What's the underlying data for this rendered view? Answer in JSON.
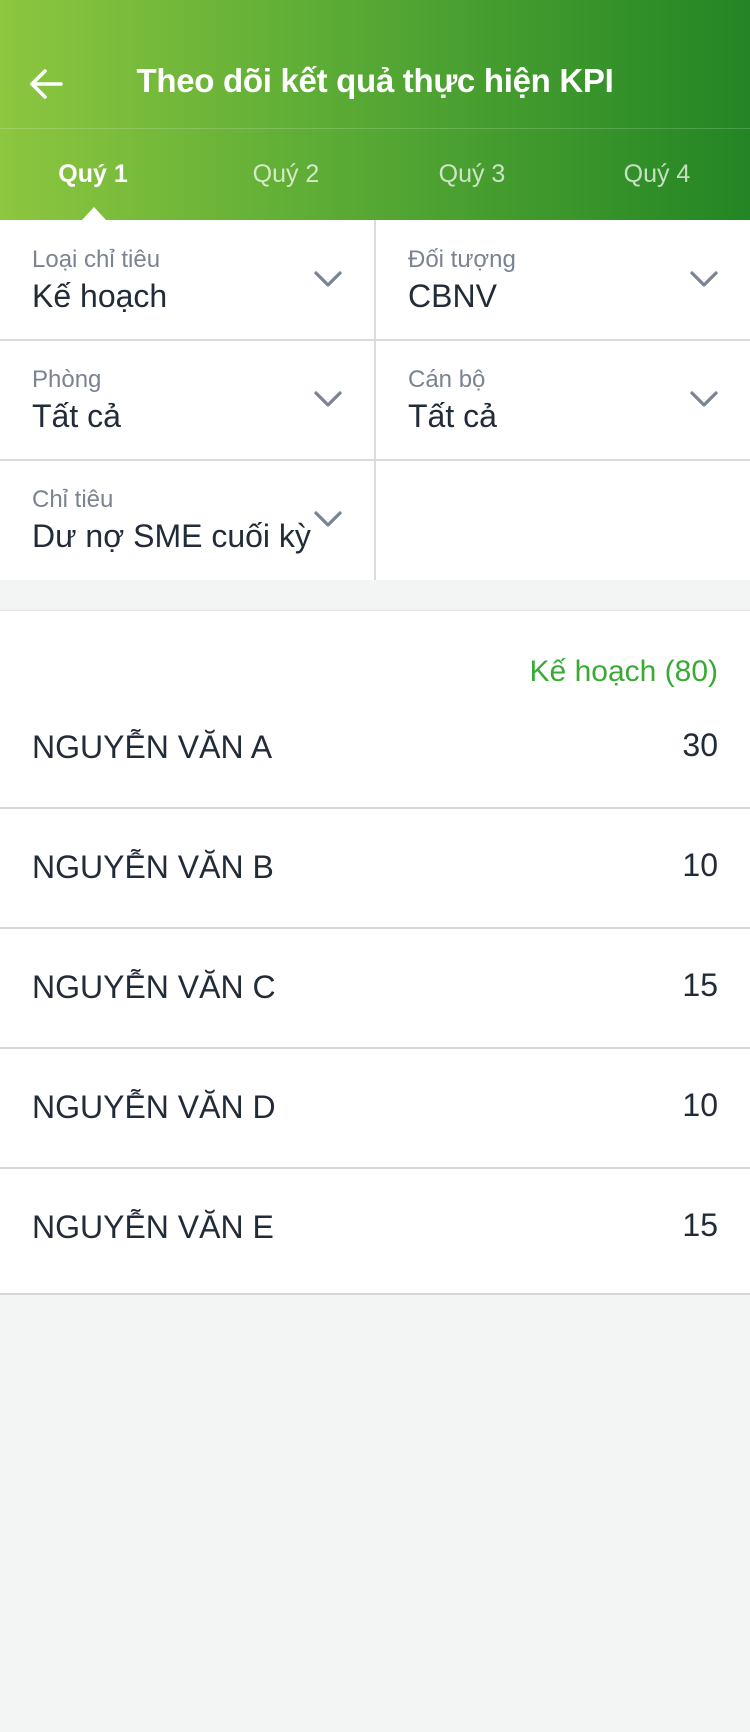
{
  "header": {
    "title": "Theo dõi kết quả thực hiện KPI",
    "back_icon": "arrow-left-icon"
  },
  "tabs": [
    {
      "label": "Quý 1",
      "active": true
    },
    {
      "label": "Quý 2",
      "active": false
    },
    {
      "label": "Quý 3",
      "active": false
    },
    {
      "label": "Quý 4",
      "active": false
    }
  ],
  "filters": {
    "loai_chi_tieu": {
      "label": "Loại chỉ tiêu",
      "value": "Kế hoạch"
    },
    "doi_tuong": {
      "label": "Đối tượng",
      "value": "CBNV"
    },
    "phong": {
      "label": "Phòng",
      "value": "Tất cả"
    },
    "can_bo": {
      "label": "Cán bộ",
      "value": "Tất cả"
    },
    "chi_tieu": {
      "label": "Chỉ tiêu",
      "value": "Dư nợ SME cuối kỳ"
    }
  },
  "list": {
    "header": "Kế hoạch (80)",
    "rows": [
      {
        "name": "NGUYỄN VĂN A",
        "value": "30"
      },
      {
        "name": "NGUYỄN VĂN B",
        "value": "10"
      },
      {
        "name": "NGUYỄN VĂN C",
        "value": "15"
      },
      {
        "name": "NGUYỄN VĂN D",
        "value": "10"
      },
      {
        "name": "NGUYỄN VĂN E",
        "value": "15"
      }
    ]
  },
  "colors": {
    "header_start": "#8dc63f",
    "header_end": "#238524",
    "accent_green": "#3aaa35",
    "chevron": "#7a8391"
  }
}
